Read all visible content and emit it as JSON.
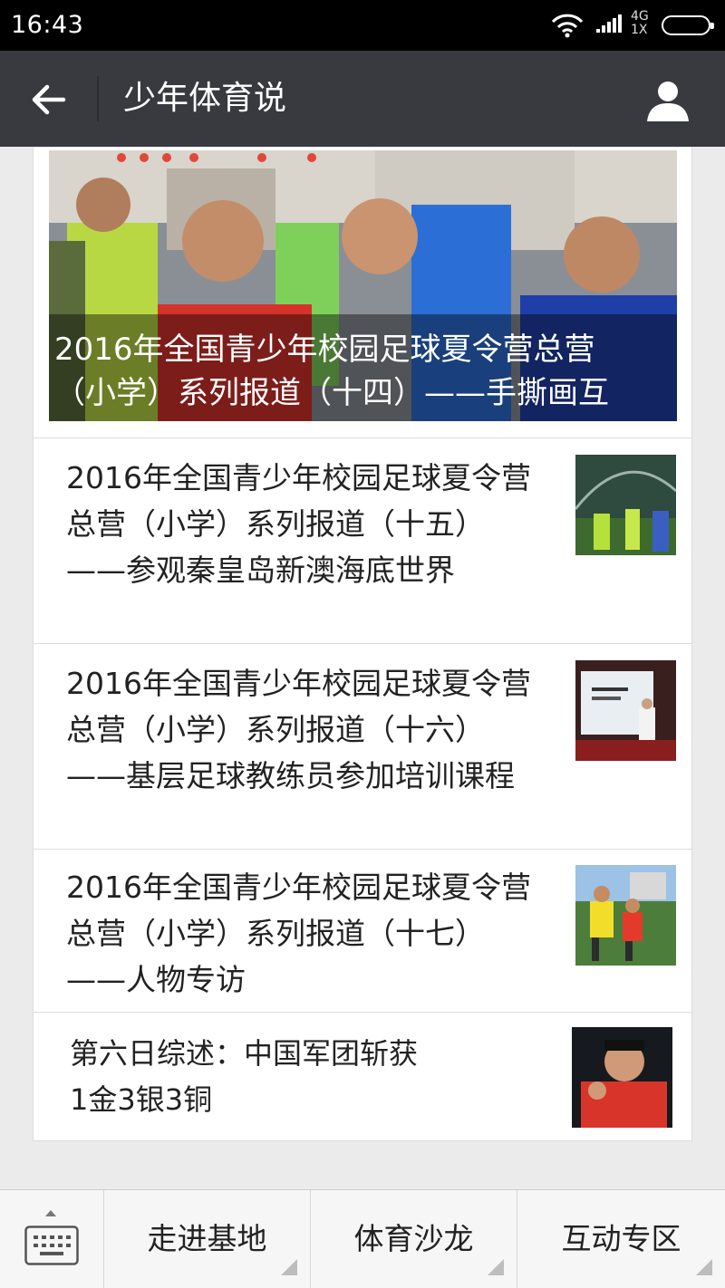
{
  "status_bar": {
    "time": "16:43",
    "network_top": "4G",
    "network_bottom": "1X"
  },
  "title_bar": {
    "title": "少年体育说",
    "back_icon": "back-arrow-icon",
    "profile_icon": "person-icon"
  },
  "hero": {
    "caption_line1": "2016年全国青少年校园足球夏令营总营",
    "caption_line2": "（小学）系列报道（十四）——手撕画互"
  },
  "articles": [
    {
      "title": "2016年全国青少年校园足球夏令营总营（小学）系列报道（十五）——参观秦皇岛新澳海底世界"
    },
    {
      "title": "2016年全国青少年校园足球夏令营总营（小学）系列报道（十六）——基层足球教练员参加培训课程"
    },
    {
      "title": "2016年全国青少年校园足球夏令营总营（小学）系列报道（十七）——人物专访"
    },
    {
      "title": "第六日综述：中国军团斩获1金3银3铜"
    }
  ],
  "menu": {
    "keyboard_icon": "keyboard-icon",
    "items": [
      {
        "label": "走进基地"
      },
      {
        "label": "体育沙龙"
      },
      {
        "label": "互动专区"
      }
    ]
  }
}
